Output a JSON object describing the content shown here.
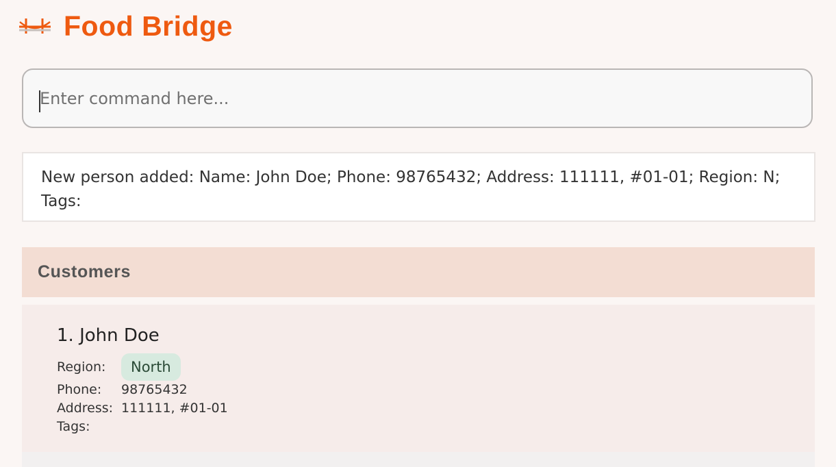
{
  "app": {
    "title": "Food Bridge",
    "logo_icon": "bridge-icon",
    "accent_color": "#ee5a10"
  },
  "command": {
    "placeholder": "Enter command here...",
    "value": ""
  },
  "result": {
    "message": "New person added: Name: John Doe; Phone: 98765432; Address: 111111, #01-01; Region: N; Tags:"
  },
  "customers": {
    "header": "Customers",
    "items": [
      {
        "index_name": "1. John Doe",
        "region_label": "Region:",
        "region_value": "North",
        "phone_label": "Phone:",
        "phone_value": "98765432",
        "address_label": "Address:",
        "address_value": "111111, #01-01",
        "tags_label": "Tags:"
      }
    ]
  }
}
